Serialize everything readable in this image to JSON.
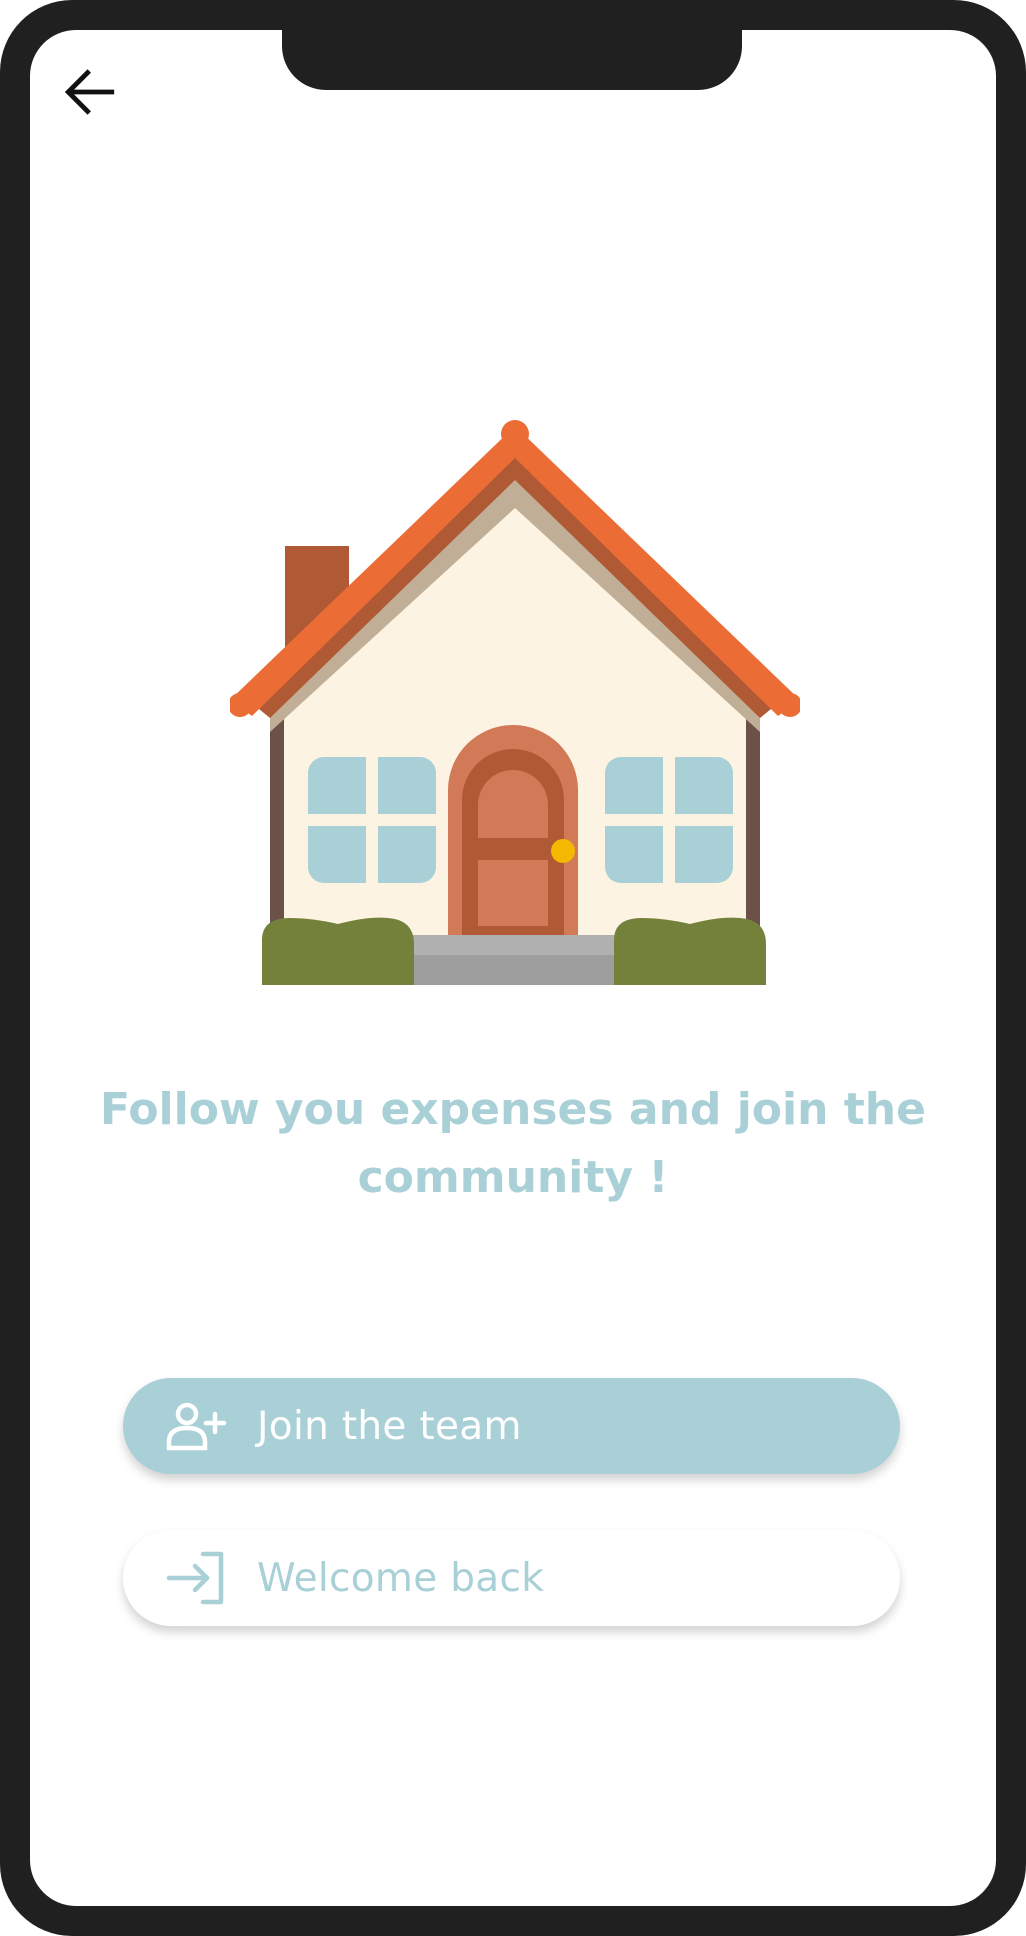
{
  "colors": {
    "accent": "#a8d0d6",
    "frame": "#202020",
    "background": "#ffffff"
  },
  "header": {
    "back_icon": "arrow-left-icon"
  },
  "illustration": {
    "icon": "house-icon"
  },
  "main": {
    "headline": "Follow you expenses and join the community !"
  },
  "actions": {
    "join": {
      "label": "Join the team",
      "icon": "user-plus-icon"
    },
    "welcome": {
      "label": "Welcome back",
      "icon": "login-icon"
    }
  }
}
